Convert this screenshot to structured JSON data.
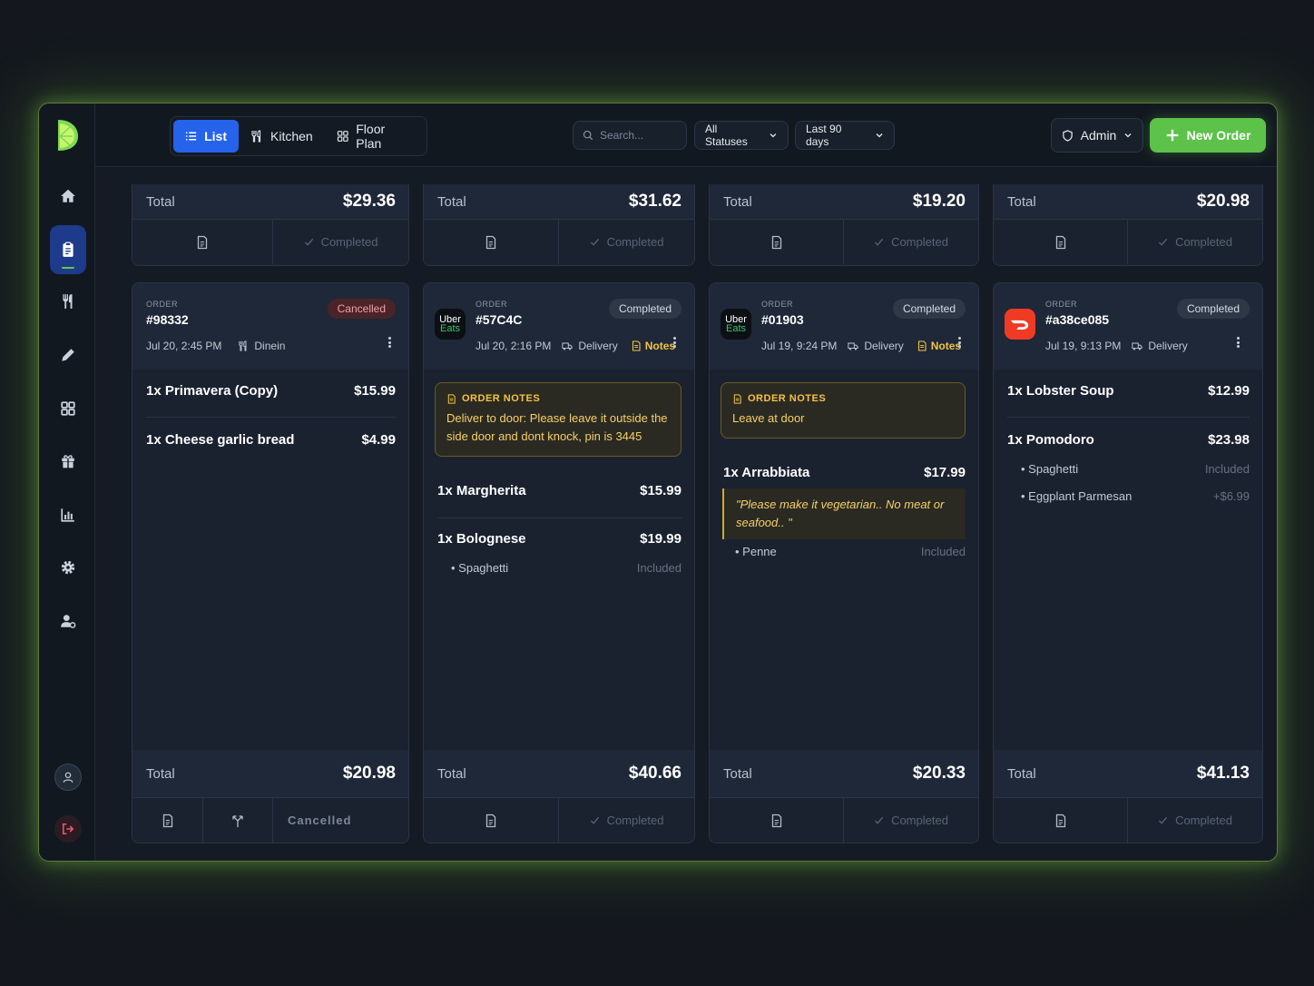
{
  "topbar": {
    "tabs": [
      {
        "label": "List",
        "icon": "list-icon",
        "active": true
      },
      {
        "label": "Kitchen",
        "icon": "utensils-icon",
        "active": false
      },
      {
        "label": "Floor Plan",
        "icon": "grid-icon",
        "active": false
      }
    ],
    "search": {
      "placeholder": "Search..."
    },
    "status_filter": "All Statuses",
    "date_filter": "Last 90 days",
    "role": "Admin",
    "new_order": "New Order"
  },
  "sidebar": {
    "items": [
      "home-icon",
      "orders-icon",
      "menu-icon",
      "edit-icon",
      "tables-icon",
      "gift-icon",
      "reports-icon",
      "settings-icon",
      "staff-icon"
    ],
    "active": "orders-icon"
  },
  "colors": {
    "accent": "#2563eb",
    "brand": "#5cc24a",
    "notes": "#f5c342",
    "cancelled": "#f2a0a6"
  },
  "top_row": [
    {
      "total_label": "Total",
      "total": "$29.36",
      "status": "Completed"
    },
    {
      "total_label": "Total",
      "total": "$31.62",
      "status": "Completed"
    },
    {
      "total_label": "Total",
      "total": "$19.20",
      "status": "Completed"
    },
    {
      "total_label": "Total",
      "total": "$20.98",
      "status": "Completed"
    }
  ],
  "orders": [
    {
      "order_label": "ORDER",
      "id": "#98332",
      "status": "Cancelled",
      "time": "Jul 20, 2:45 PM",
      "type": "Dinein",
      "items": [
        {
          "name": "1x Primavera (Copy)",
          "price": "$15.99"
        },
        {
          "name": "1x Cheese garlic bread",
          "price": "$4.99"
        }
      ],
      "total_label": "Total",
      "total": "$20.98",
      "footer_status": "Cancelled"
    },
    {
      "order_label": "ORDER",
      "id": "#57C4C",
      "status": "Completed",
      "time": "Jul 20, 2:16 PM",
      "type": "Delivery",
      "notes_label": "Notes",
      "brand": {
        "line1": "Uber",
        "line2": "Eats"
      },
      "order_notes": {
        "title": "ORDER NOTES",
        "text": "Deliver to door: Please leave it outside the side door and dont knock, pin is 3445"
      },
      "items": [
        {
          "name": "1x Margherita",
          "price": "$15.99"
        },
        {
          "name": "1x Bolognese",
          "price": "$19.99",
          "mods": [
            {
              "name": "Spaghetti",
              "price": "Included"
            }
          ]
        }
      ],
      "total_label": "Total",
      "total": "$40.66",
      "footer_status": "Completed"
    },
    {
      "order_label": "ORDER",
      "id": "#01903",
      "status": "Completed",
      "time": "Jul 19, 9:24 PM",
      "type": "Delivery",
      "notes_label": "Notes",
      "brand": {
        "line1": "Uber",
        "line2": "Eats"
      },
      "order_notes": {
        "title": "ORDER NOTES",
        "text": "Leave at door"
      },
      "items": [
        {
          "name": "1x Arrabbiata",
          "price": "$17.99",
          "note": "\"Please make it vegetarian.. No meat or seafood.. \"",
          "mods": [
            {
              "name": "Penne",
              "price": "Included"
            }
          ]
        }
      ],
      "total_label": "Total",
      "total": "$20.33",
      "footer_status": "Completed"
    },
    {
      "order_label": "ORDER",
      "id": "#a38ce085",
      "status": "Completed",
      "time": "Jul 19, 9:13 PM",
      "type": "Delivery",
      "items": [
        {
          "name": "1x Lobster Soup",
          "price": "$12.99"
        },
        {
          "name": "1x Pomodoro",
          "price": "$23.98",
          "mods": [
            {
              "name": "Spaghetti",
              "price": "Included"
            },
            {
              "name": "Eggplant Parmesan",
              "price": "+$6.99"
            }
          ]
        }
      ],
      "total_label": "Total",
      "total": "$41.13",
      "footer_status": "Completed"
    }
  ]
}
